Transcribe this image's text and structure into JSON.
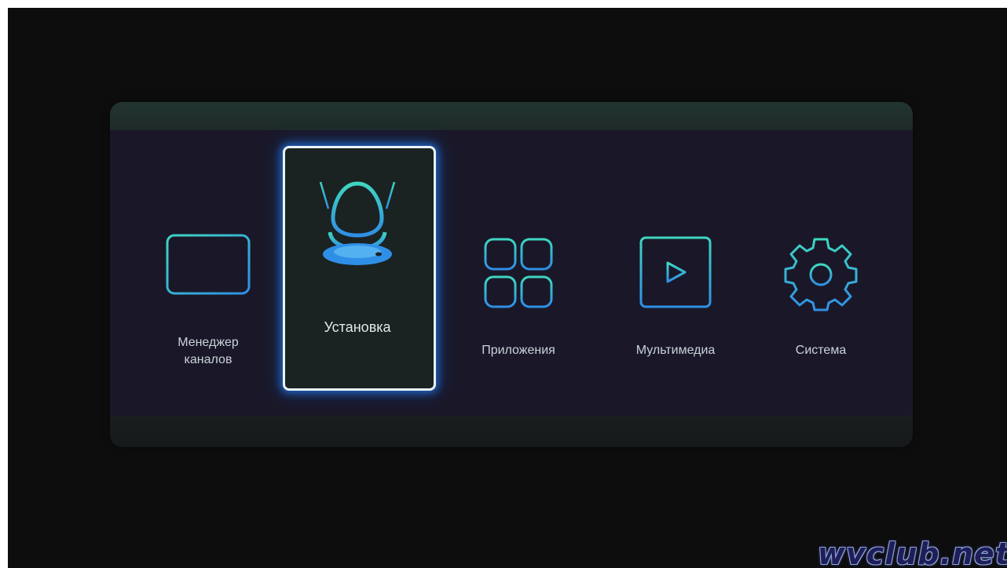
{
  "menu": {
    "items": [
      {
        "id": "channel-manager",
        "label": "Менеджер\nканалов",
        "icon": "tv-monitor-icon",
        "selected": false
      },
      {
        "id": "installation",
        "label": "Установка",
        "icon": "satellite-antenna-icon",
        "selected": true
      },
      {
        "id": "applications",
        "label": "Приложения",
        "icon": "apps-grid-icon",
        "selected": false
      },
      {
        "id": "multimedia",
        "label": "Мультимедиа",
        "icon": "media-player-icon",
        "selected": false
      },
      {
        "id": "system",
        "label": "Система",
        "icon": "gear-icon",
        "selected": false
      }
    ]
  },
  "watermark": {
    "text": "wvclub.net"
  },
  "colors": {
    "background": "#0d0d0e",
    "panel": "#1a1828",
    "icon_gradient_start": "#3fd6c1",
    "icon_gradient_end": "#2f8fe6",
    "selection_border": "#e9f2f4",
    "selection_glow": "#2378e6"
  }
}
